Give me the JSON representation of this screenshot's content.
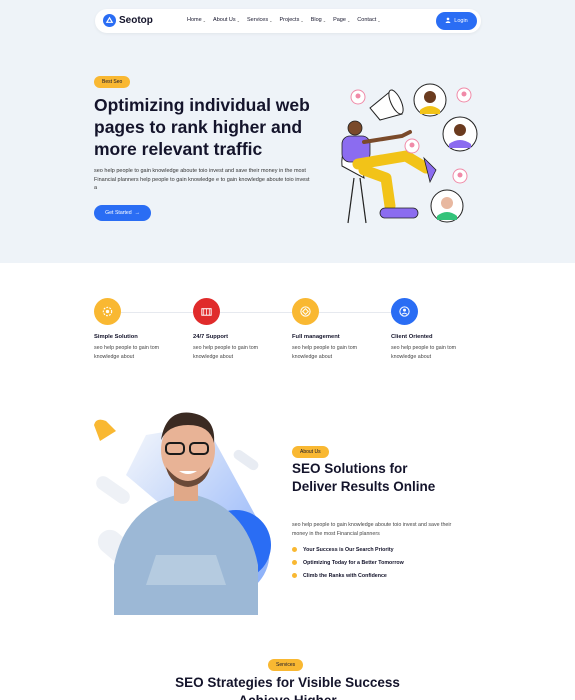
{
  "header": {
    "logo_text": "Seotop",
    "nav": [
      {
        "label": "Home",
        "dropdown": true
      },
      {
        "label": "About Us",
        "dropdown": true
      },
      {
        "label": "Services",
        "dropdown": true
      },
      {
        "label": "Projects",
        "dropdown": true
      },
      {
        "label": "Blog",
        "dropdown": true
      },
      {
        "label": "Page",
        "dropdown": true
      },
      {
        "label": "Contact",
        "dropdown": true
      }
    ],
    "login_label": "Login"
  },
  "hero": {
    "badge": "Best Seo",
    "title": "Optimizing individual web pages to rank higher and more relevant traffic",
    "description": "seo help people to gain knowledge aboute toio invest and save their money in the most Financial planners help people to gain knowledge e to gain knowledge aboute toio invest a",
    "cta_label": "Get Started"
  },
  "features": [
    {
      "title": "Simple Solution",
      "description": "seo help people to gain tom knowledge about",
      "icon": "settings-icon",
      "color": "#f9b832"
    },
    {
      "title": "24/7 Support",
      "description": "seo help people to gain tom knowledge about",
      "icon": "support-icon",
      "color": "#e02b2b"
    },
    {
      "title": "Full management",
      "description": "seo help people to gain tom knowledge about",
      "icon": "management-icon",
      "color": "#f9b832"
    },
    {
      "title": "Client Oriented",
      "description": "seo help people to gain tom knowledge about",
      "icon": "client-icon",
      "color": "#2a6df4"
    }
  ],
  "about": {
    "badge": "About Us",
    "title": "SEO Solutions for Deliver Results Online",
    "description": "seo help people to gain knowledge aboute toio invest and save their money in the most Financial planners",
    "checklist": [
      "Your Success is Our Search Priority",
      "Optimizing Today for a Better Tomorrow",
      "Climb the Ranks with Confidence"
    ]
  },
  "services": {
    "badge": "Services",
    "title": "SEO Strategies for  Visible Success Achieve Higher"
  },
  "colors": {
    "accent": "#2a6df4",
    "badge": "#f9b832",
    "hero_bg": "#eef3f8"
  }
}
